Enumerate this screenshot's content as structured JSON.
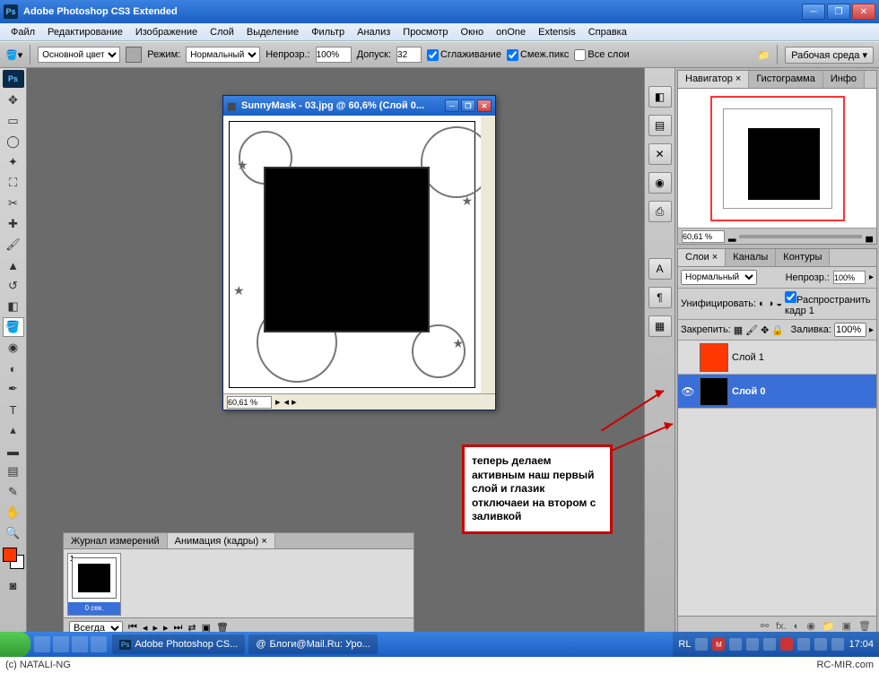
{
  "window": {
    "title": "Adobe Photoshop CS3 Extended"
  },
  "menu": [
    "Файл",
    "Редактирование",
    "Изображение",
    "Слой",
    "Выделение",
    "Фильтр",
    "Анализ",
    "Просмотр",
    "Окно",
    "onOne",
    "Extensis",
    "Справка"
  ],
  "options": {
    "fill_label": "Основной цвет",
    "mode_label": "Режим:",
    "mode_value": "Нормальный",
    "opacity_label": "Непрозр.:",
    "opacity": "100%",
    "tolerance_label": "Допуск:",
    "tolerance": "32",
    "antialias": "Сглаживание",
    "contiguous": "Смеж.пикс",
    "all_layers": "Все слои",
    "workspace_label": "Рабочая среда"
  },
  "document": {
    "title": "SunnyMask - 03.jpg @ 60,6% (Слой 0...",
    "zoom": "60,61 %"
  },
  "navigator": {
    "tabs": [
      "Навигатор ×",
      "Гистограмма",
      "Инфо"
    ],
    "zoom": "60,61 %"
  },
  "layers": {
    "tabs": [
      "Слои ×",
      "Каналы",
      "Контуры"
    ],
    "blend": "Нормальный",
    "opacity_label": "Непрозр.:",
    "opacity": "100%",
    "unify_label": "Унифицировать:",
    "propagate": "Распространить кадр 1",
    "lock_label": "Закрепить:",
    "fill_label": "Заливка:",
    "fill": "100%",
    "items": [
      {
        "name": "Слой 1",
        "visible": false,
        "color": "red"
      },
      {
        "name": "Слой 0",
        "visible": true,
        "color": "mask",
        "selected": true
      }
    ]
  },
  "animation": {
    "tabs": [
      "Журнал измерений",
      "Анимация (кадры) ×"
    ],
    "frame_label": "0 сек.",
    "loop": "Всегда"
  },
  "annotation": "теперь делаем активным наш первый слой и глазик отключаеи на втором с заливкой",
  "taskbar": {
    "tasks": [
      "Adobe Photoshop CS...",
      "Блоги@Mail.Ru: Уро..."
    ],
    "lang": "RL",
    "time": "17:04"
  },
  "footer": {
    "left": "(c) NATALI-NG",
    "right": "RC-MIR.com"
  }
}
